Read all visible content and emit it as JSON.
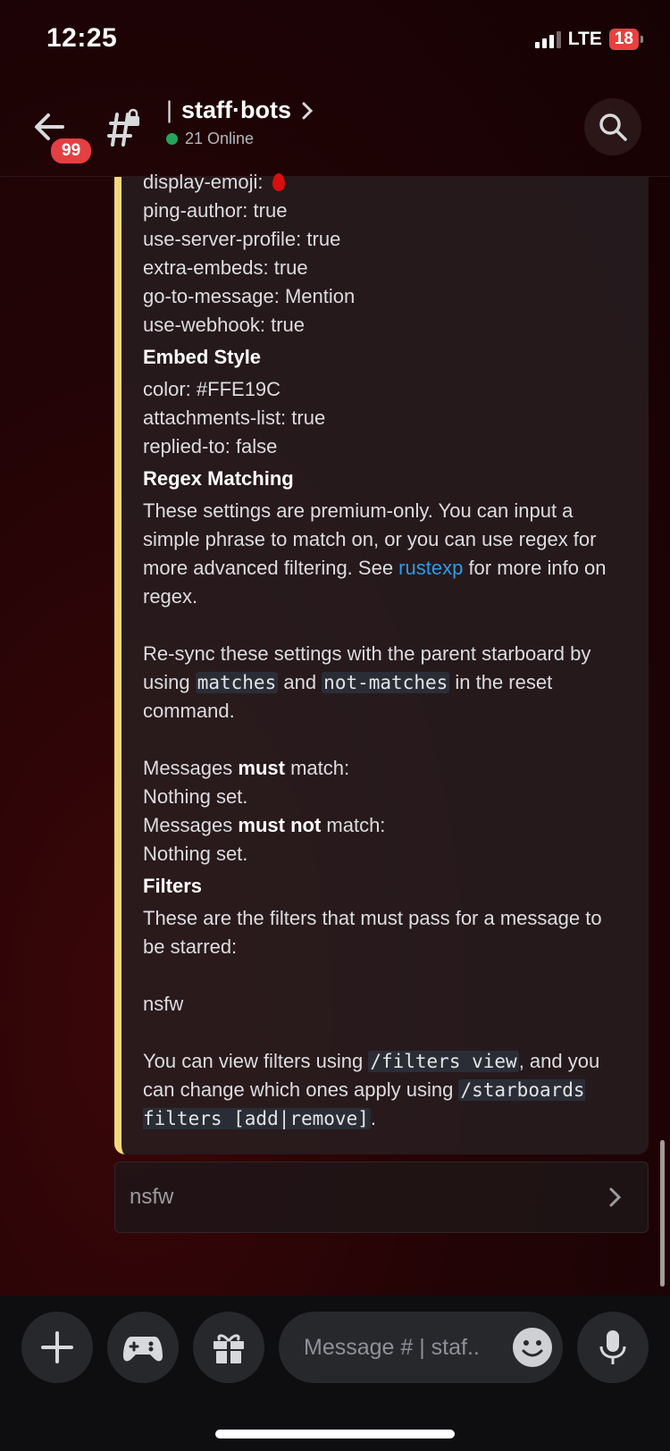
{
  "status_bar": {
    "time": "12:25",
    "network": "LTE",
    "battery": "18"
  },
  "header": {
    "badge_count": "99",
    "channel_name": "staff·bots",
    "online_text": "21 Online"
  },
  "embed": {
    "settings_lines": [
      "display-emoji:",
      "ping-author: true",
      "use-server-profile: true",
      "extra-embeds: true",
      "go-to-message: Mention",
      "use-webhook: true"
    ],
    "embed_style_heading": "Embed Style",
    "embed_style_lines": [
      "color: #FFE19C",
      "attachments-list: true",
      "replied-to: false"
    ],
    "regex_heading": "Regex Matching",
    "regex_intro_1": "These settings are premium-only. You can input a simple phrase to match on, or you can use regex for more advanced filtering. See ",
    "regex_link": "rustexp",
    "regex_intro_2": " for more info on regex.",
    "resync_1": "Re-sync these settings with the parent starboard by using ",
    "resync_code_1": "matches",
    "resync_2": " and ",
    "resync_code_2": "not-matches",
    "resync_3": " in the reset command.",
    "must_prefix": "Messages ",
    "must_bold": "must",
    "must_suffix": " match:",
    "must_value": "Nothing set.",
    "mustnot_prefix": "Messages ",
    "mustnot_bold": "must not",
    "mustnot_suffix": " match:",
    "mustnot_value": "Nothing set.",
    "filters_heading": "Filters",
    "filters_intro": "These are the filters that must pass for a message to be starred:",
    "filters_value": "nsfw",
    "view_1": "You can view filters using ",
    "view_code_1": "/filters view",
    "view_2": ", and you can change which ones apply using ",
    "view_code_2": "/starboards filters [add|remove]",
    "view_3": "."
  },
  "select_menu": {
    "value": "nsfw"
  },
  "composer": {
    "placeholder": "Message # | staf.."
  },
  "colors": {
    "embed_accent": "#f4d97c",
    "badge": "#e43f43",
    "online": "#23a55a",
    "link": "#2b9de6"
  }
}
